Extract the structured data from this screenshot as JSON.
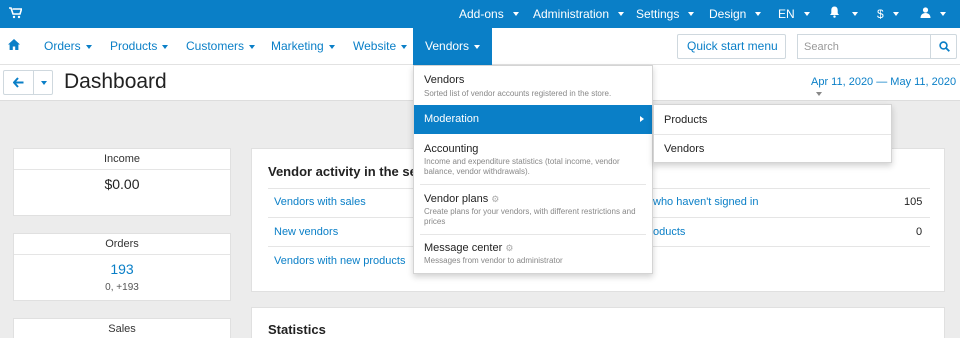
{
  "topbar": {
    "addons": "Add-ons",
    "administration": "Administration",
    "settings": "Settings",
    "design": "Design",
    "language": "EN",
    "currency": "$"
  },
  "mainnav": {
    "orders": "Orders",
    "products": "Products",
    "customers": "Customers",
    "marketing": "Marketing",
    "website": "Website",
    "vendors": "Vendors",
    "quick_start": "Quick start menu",
    "search_placeholder": "Search"
  },
  "header": {
    "title": "Dashboard",
    "date_range": "Apr 11, 2020 — May 11, 2020"
  },
  "kpis": {
    "income_label": "Income",
    "income_value": "$0.00",
    "orders_label": "Orders",
    "orders_value": "193",
    "orders_sub": "0, +193",
    "sales_label": "Sales"
  },
  "vendor_activity": {
    "title": "Vendor activity in the sele",
    "rows_left": [
      "Vendors with sales",
      "New vendors",
      "Vendors with new products"
    ],
    "rows_right": [
      {
        "label": "who haven't signed in",
        "value": "105"
      },
      {
        "label": "oducts",
        "value": "0"
      }
    ]
  },
  "statistics": {
    "title": "Statistics"
  },
  "dropdown": {
    "items": [
      {
        "title": "Vendors",
        "desc": "Sorted list of vendor accounts registered in the store."
      },
      {
        "title": "Moderation",
        "desc": ""
      },
      {
        "title": "Accounting",
        "desc": "Income and expenditure statistics (total income, vendor balance, vendor withdrawals)."
      },
      {
        "title": "Vendor plans",
        "desc": "Create plans for your vendors, with different restrictions and prices"
      },
      {
        "title": "Message center",
        "desc": "Messages from vendor to administrator"
      }
    ]
  },
  "submenu": {
    "items": [
      "Products",
      "Vendors"
    ]
  },
  "colors": {
    "accent": "#0a7fc7"
  }
}
